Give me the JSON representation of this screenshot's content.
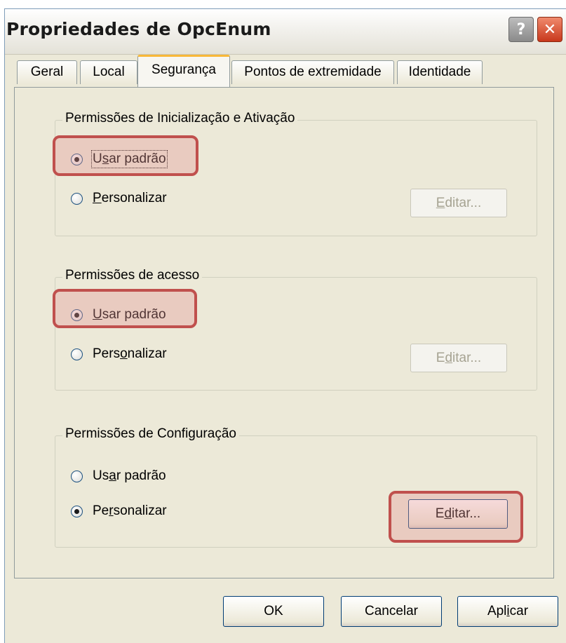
{
  "window": {
    "title": "Propriedades de OpcEnum",
    "help_glyph": "?",
    "close_glyph": "✕"
  },
  "tabs": [
    {
      "label": "Geral",
      "active": false
    },
    {
      "label": "Local",
      "active": false
    },
    {
      "label": "Segurança",
      "active": true
    },
    {
      "label": "Pontos de extremidade",
      "active": false
    },
    {
      "label": "Identidade",
      "active": false
    }
  ],
  "groups": {
    "launch": {
      "legend": "Permissões de Inicialização e Ativação",
      "opt_default": {
        "pre": "U",
        "key": "s",
        "post": "ar padrão",
        "checked": true
      },
      "opt_custom": {
        "pre": "",
        "key": "P",
        "post": "ersonalizar",
        "checked": false
      },
      "edit": {
        "pre": "",
        "key": "E",
        "post": "ditar...",
        "enabled": false
      }
    },
    "access": {
      "legend": "Permissões de acesso",
      "opt_default": {
        "pre": "",
        "key": "U",
        "post": "sar padrão",
        "checked": true
      },
      "opt_custom": {
        "pre": "Pers",
        "key": "o",
        "post": "nalizar",
        "checked": false
      },
      "edit": {
        "pre": "E",
        "key": "d",
        "post": "itar...",
        "enabled": false
      }
    },
    "config": {
      "legend": "Permissões de Configuração",
      "opt_default": {
        "pre": "Us",
        "key": "a",
        "post": "r padrão",
        "checked": false
      },
      "opt_custom": {
        "pre": "Pe",
        "key": "r",
        "post": "sonalizar",
        "checked": true
      },
      "edit": {
        "pre": "E",
        "key": "d",
        "post": "itar...",
        "enabled": true
      }
    }
  },
  "footer": {
    "ok": {
      "pre": "OK",
      "key": "",
      "post": ""
    },
    "cancel": {
      "pre": "Cancelar",
      "key": "",
      "post": ""
    },
    "apply": {
      "pre": "Apl",
      "key": "i",
      "post": "car"
    }
  },
  "colors": {
    "highlight_border": "#c0504d",
    "dialog_bg": "#ece9d8",
    "active_tab_accent": "#f8b838",
    "button_border": "#003c74"
  }
}
